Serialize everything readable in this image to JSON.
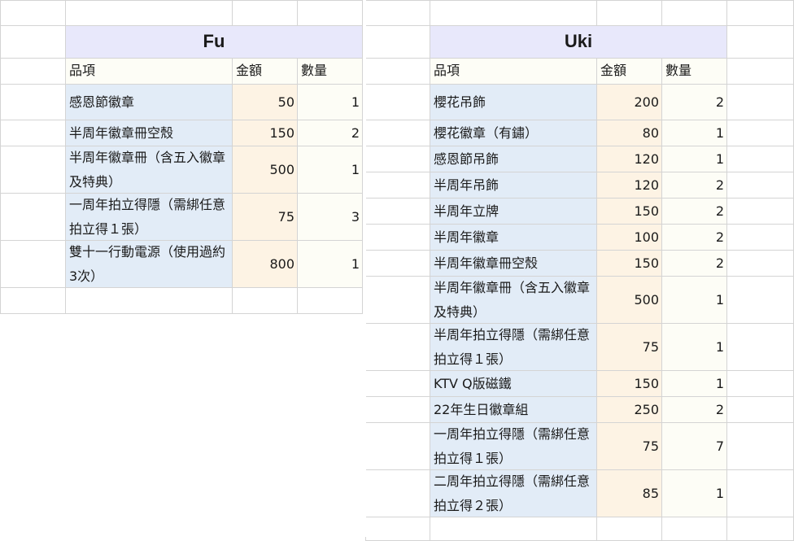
{
  "headers": {
    "item": "品項",
    "amount": "金額",
    "qty": "數量"
  },
  "fu": {
    "title": "Fu",
    "rows": [
      {
        "item": "感恩節徽章",
        "amount": "50",
        "qty": "1"
      },
      {
        "item": "半周年徽章冊空殼",
        "amount": "150",
        "qty": "2"
      },
      {
        "item": "半周年徽章冊（含五入徽章及特典）",
        "amount": "500",
        "qty": "1"
      },
      {
        "item": "一周年拍立得隱（需綁任意拍立得１張）",
        "amount": "75",
        "qty": "3"
      },
      {
        "item": "雙十一行動電源（使用過約3次）",
        "amount": "800",
        "qty": "1"
      }
    ]
  },
  "uki": {
    "title": "Uki",
    "rows": [
      {
        "item": "櫻花吊飾",
        "amount": "200",
        "qty": "2"
      },
      {
        "item": "櫻花徽章（有鏽）",
        "amount": "80",
        "qty": "1"
      },
      {
        "item": "感恩節吊飾",
        "amount": "120",
        "qty": "1"
      },
      {
        "item": "半周年吊飾",
        "amount": "120",
        "qty": "2"
      },
      {
        "item": "半周年立牌",
        "amount": "150",
        "qty": "2"
      },
      {
        "item": "半周年徽章",
        "amount": "100",
        "qty": "2"
      },
      {
        "item": "半周年徽章冊空殼",
        "amount": "150",
        "qty": "2"
      },
      {
        "item": "半周年徽章冊（含五入徽章及特典）",
        "amount": "500",
        "qty": "1"
      },
      {
        "item": "半周年拍立得隱（需綁任意拍立得１張）",
        "amount": "75",
        "qty": "1"
      },
      {
        "item": "KTV Q版磁鐵",
        "amount": "150",
        "qty": "1"
      },
      {
        "item": "22年生日徽章組",
        "amount": "250",
        "qty": "2"
      },
      {
        "item": "一周年拍立得隱（需綁任意拍立得１張）",
        "amount": "75",
        "qty": "7"
      },
      {
        "item": "二周年拍立得隱（需綁任意拍立得２張）",
        "amount": "85",
        "qty": "1"
      }
    ]
  }
}
